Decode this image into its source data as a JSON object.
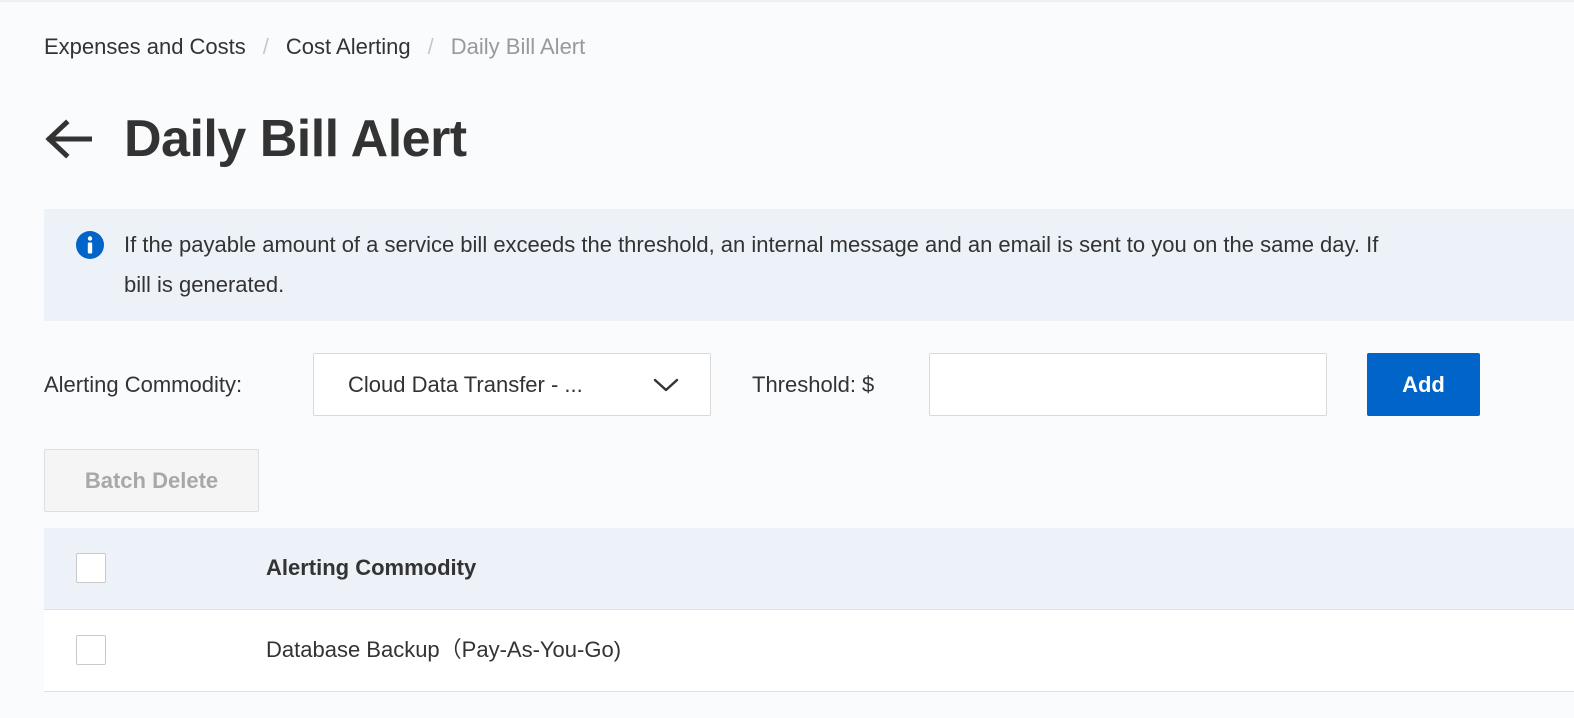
{
  "breadcrumb": {
    "items": [
      "Expenses and Costs",
      "Cost Alerting",
      "Daily Bill Alert"
    ],
    "separator": "/"
  },
  "page": {
    "title": "Daily Bill Alert",
    "back_icon": "arrow-left-icon"
  },
  "notice": {
    "icon": "info-icon",
    "line1": "If the payable amount of a service bill exceeds the threshold, an internal message and an email is sent to you on the same day. If",
    "line2": "bill is generated."
  },
  "form": {
    "commodity_label": "Alerting Commodity:",
    "commodity_value": "Cloud Data Transfer - ...",
    "threshold_label": "Threshold: $",
    "threshold_value": "",
    "add_label": "Add"
  },
  "toolbar": {
    "batch_delete_label": "Batch Delete"
  },
  "table": {
    "columns": [
      "Alerting Commodity"
    ],
    "rows": [
      {
        "commodity": "Database Backup（Pay-As-You-Go)"
      }
    ]
  },
  "colors": {
    "primary": "#0064c8",
    "info": "#0064c8",
    "notice_bg": "#edf1f8"
  }
}
